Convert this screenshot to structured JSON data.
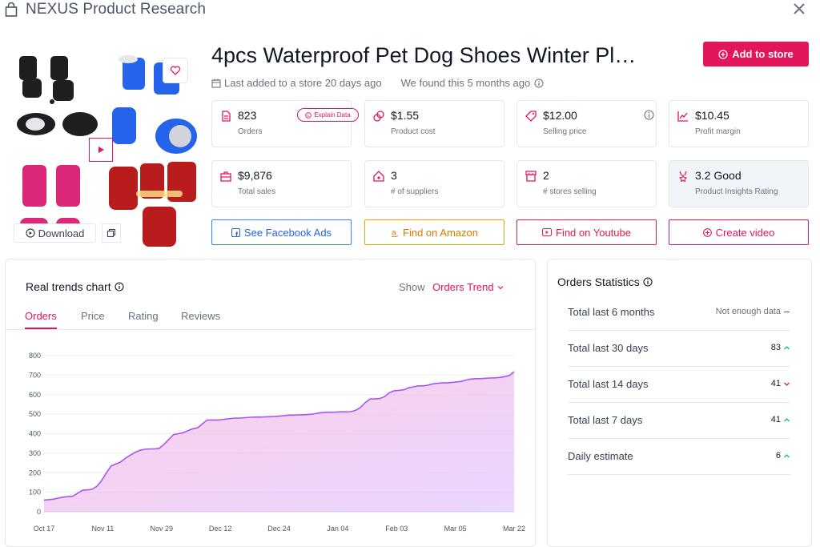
{
  "app": {
    "title": "NEXUS Product Research"
  },
  "product": {
    "title": "4pcs Waterproof Pet Dog Shoes Winter Pl…",
    "added": "Last added to a store 20 days ago",
    "found": "We found this 5 months ago",
    "add_button": "Add to store",
    "download_label": "Download"
  },
  "metrics": [
    {
      "value": "823",
      "label": "Orders",
      "icon": "document-icon",
      "badge": "Explain Data"
    },
    {
      "value": "$1.55",
      "label": "Product cost",
      "icon": "coins-icon"
    },
    {
      "value": "$12.00",
      "label": "Selling price",
      "icon": "tag-icon"
    },
    {
      "value": "$10.45",
      "label": "Profit margin",
      "icon": "trend-up-icon"
    },
    {
      "value": "$9,876",
      "label": "Total sales",
      "icon": "briefcase-icon"
    },
    {
      "value": "3",
      "label": "# of suppliers",
      "icon": "home-icon"
    },
    {
      "value": "2",
      "label": "# stores selling",
      "icon": "store-icon"
    },
    {
      "value": "3.2 Good",
      "label": "Product Insights Rating",
      "icon": "award-icon"
    }
  ],
  "actions": [
    {
      "label": "See Facebook Ads",
      "color": "#3b82f6",
      "icon": "facebook-icon"
    },
    {
      "label": "Find on Amazon",
      "color": "#f59e0b",
      "icon": "amazon-icon"
    },
    {
      "label": "Find on Youtube",
      "color": "#e11d48",
      "icon": "youtube-icon"
    },
    {
      "label": "Create video",
      "color": "#e2165b",
      "icon": "plus-circle-icon"
    }
  ],
  "trends": {
    "title": "Real trends chart",
    "show_label": "Show",
    "selected": "Orders Trend",
    "tabs": [
      "Orders",
      "Price",
      "Rating",
      "Reviews"
    ],
    "active_tab": "Orders"
  },
  "chart_data": {
    "type": "area",
    "ylim": [
      0,
      800
    ],
    "yticks": [
      0,
      100,
      200,
      300,
      400,
      500,
      600,
      700,
      800
    ],
    "xticks": [
      "Oct 17",
      "Nov 11",
      "Nov 29",
      "Dec 12",
      "Dec 24",
      "Jan 04",
      "Feb 03",
      "Mar 05",
      "Mar 22"
    ],
    "grid": true,
    "values": [
      60,
      62,
      65,
      70,
      75,
      78,
      80,
      95,
      110,
      112,
      115,
      130,
      160,
      200,
      235,
      245,
      255,
      275,
      290,
      305,
      315,
      320,
      322,
      322,
      325,
      345,
      370,
      395,
      400,
      405,
      415,
      425,
      430,
      450,
      470,
      470,
      470,
      472,
      475,
      478,
      480,
      480,
      482,
      484,
      485,
      485,
      486,
      487,
      488,
      490,
      492,
      495,
      495,
      496,
      497,
      498,
      500,
      505,
      508,
      510,
      510,
      511,
      512,
      512,
      513,
      520,
      535,
      560,
      578,
      578,
      580,
      590,
      610,
      620,
      622,
      625,
      635,
      640,
      645,
      645,
      648,
      655,
      658,
      660,
      660,
      662,
      665,
      668,
      675,
      680,
      682,
      682,
      684,
      685,
      686,
      688,
      692,
      698,
      718
    ],
    "color": "#a855f7"
  },
  "stats": {
    "title": "Orders Statistics",
    "rows": [
      {
        "label": "Total last 6 months",
        "value": "Not enough data",
        "trend": "dash"
      },
      {
        "label": "Total last 30 days",
        "value": "83",
        "trend": "up"
      },
      {
        "label": "Total last 14 days",
        "value": "41",
        "trend": "down"
      },
      {
        "label": "Total last 7 days",
        "value": "41",
        "trend": "up"
      },
      {
        "label": "Daily estimate",
        "value": "6",
        "trend": "up"
      }
    ]
  }
}
